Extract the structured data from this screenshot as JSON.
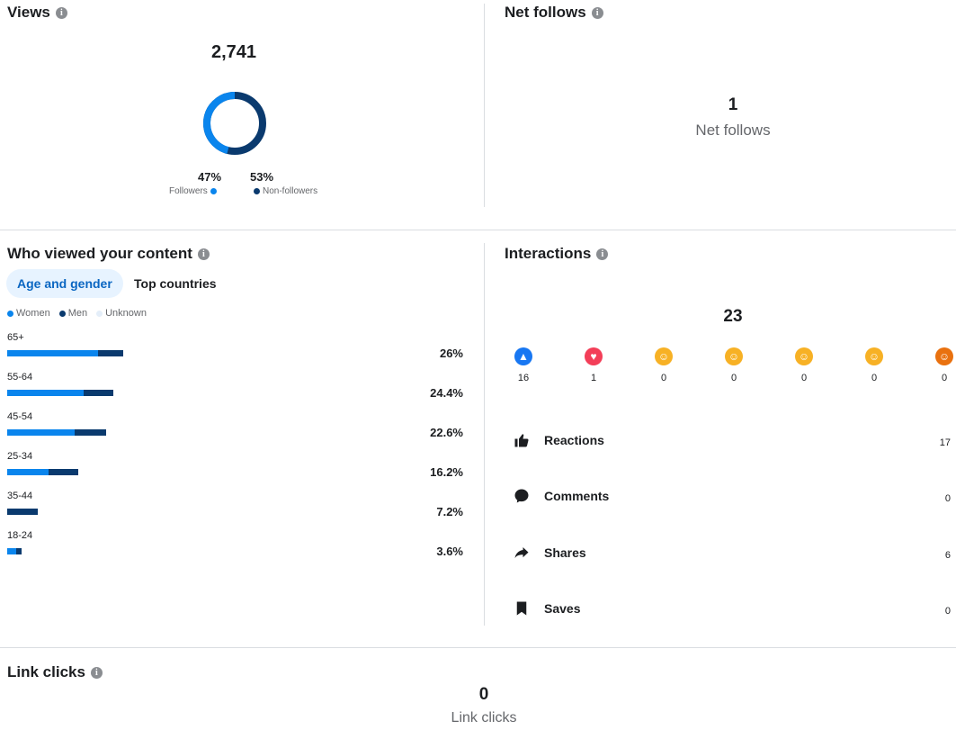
{
  "views": {
    "title": "Views",
    "total": "2,741",
    "followers_pct": "47%",
    "non_followers_pct": "53%",
    "followers_label": "Followers",
    "non_followers_label": "Non-followers",
    "followers_fraction": 0.47,
    "colors": {
      "followers": "#0a85ed",
      "non_followers": "#0a3a6e"
    }
  },
  "net_follows": {
    "title": "Net follows",
    "value": "1",
    "label": "Net follows"
  },
  "who_viewed": {
    "title": "Who viewed your content",
    "tabs": [
      {
        "label": "Age and gender",
        "active": true
      },
      {
        "label": "Top countries",
        "active": false
      }
    ],
    "legend": {
      "women": "Women",
      "men": "Men",
      "unknown": "Unknown"
    },
    "rows": [
      {
        "age": "65+",
        "pct": "26%",
        "women_fraction": 0.2,
        "men_fraction": 0.055
      },
      {
        "age": "55-64",
        "pct": "24.4%",
        "women_fraction": 0.168,
        "men_fraction": 0.066
      },
      {
        "age": "45-54",
        "pct": "22.6%",
        "women_fraction": 0.148,
        "men_fraction": 0.07
      },
      {
        "age": "25-34",
        "pct": "16.2%",
        "women_fraction": 0.092,
        "men_fraction": 0.066
      },
      {
        "age": "35-44",
        "pct": "7.2%",
        "women_fraction": 0.0,
        "men_fraction": 0.068
      },
      {
        "age": "18-24",
        "pct": "3.6%",
        "women_fraction": 0.02,
        "men_fraction": 0.012
      }
    ]
  },
  "interactions": {
    "title": "Interactions",
    "total": "23",
    "reactions": [
      {
        "name": "like-icon",
        "count": "16",
        "color": "#1877f2"
      },
      {
        "name": "love-icon",
        "count": "1",
        "color": "#f33e58"
      },
      {
        "name": "care-icon",
        "count": "0",
        "color": "#f7b125"
      },
      {
        "name": "haha-icon",
        "count": "0",
        "color": "#f7b125"
      },
      {
        "name": "wow-icon",
        "count": "0",
        "color": "#f7b125"
      },
      {
        "name": "sad-icon",
        "count": "0",
        "color": "#f7b125"
      },
      {
        "name": "angry-icon",
        "count": "0",
        "color": "#e9710f"
      }
    ],
    "metrics": [
      {
        "label": "Reactions",
        "value": "17",
        "icon": "thumbs-up-icon"
      },
      {
        "label": "Comments",
        "value": "0",
        "icon": "comment-icon"
      },
      {
        "label": "Shares",
        "value": "6",
        "icon": "share-icon"
      },
      {
        "label": "Saves",
        "value": "0",
        "icon": "bookmark-icon"
      }
    ]
  },
  "link_clicks": {
    "title": "Link clicks",
    "value": "0",
    "label": "Link clicks"
  }
}
